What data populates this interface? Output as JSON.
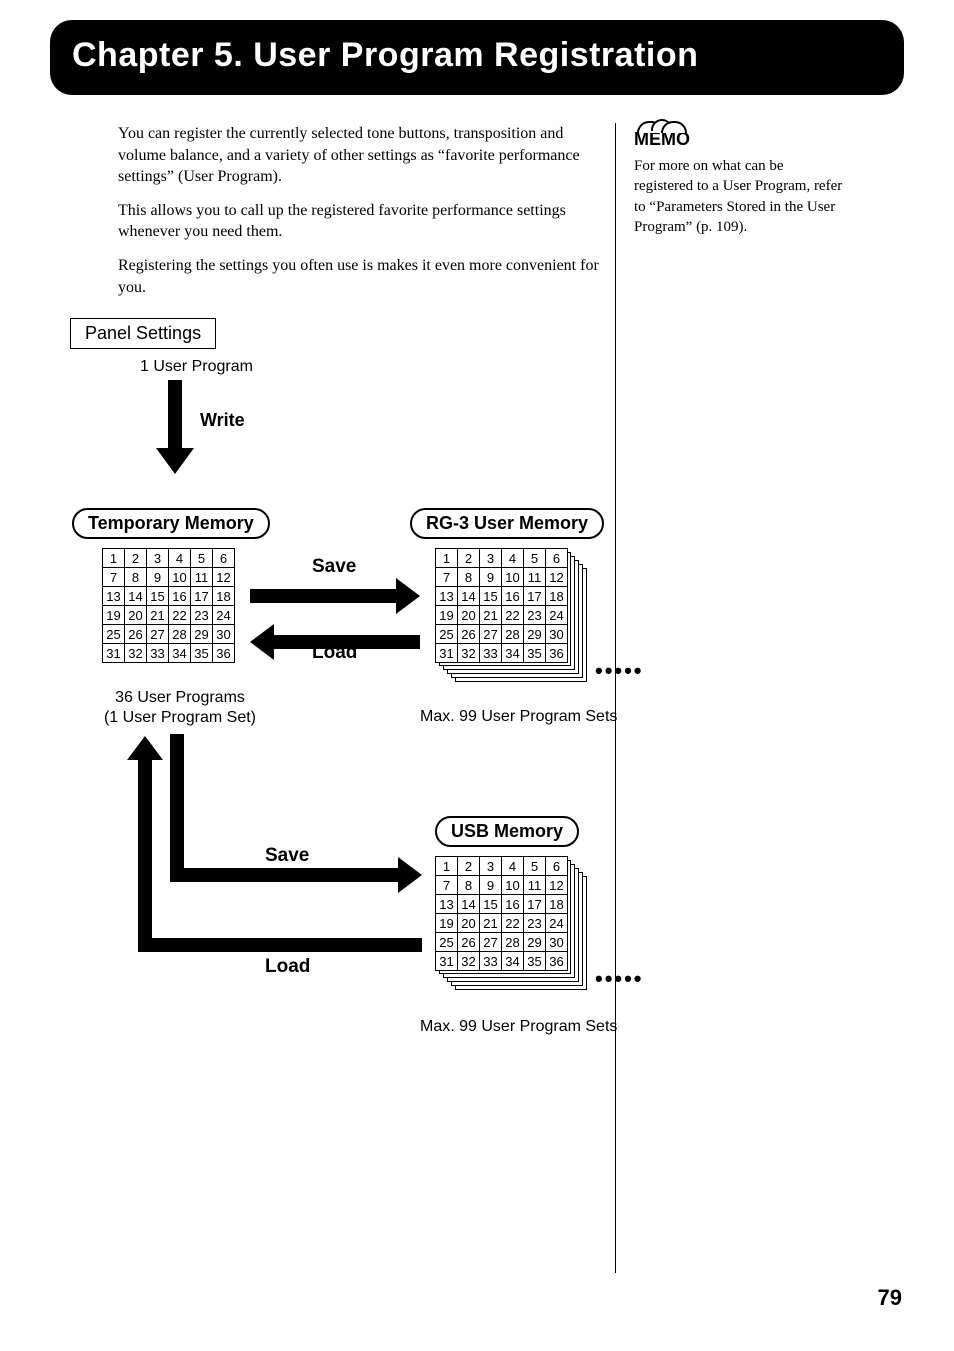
{
  "chapter_title": "Chapter 5. User Program Registration",
  "intro": {
    "p1": "You can register the currently selected tone buttons, transposition and volume balance, and a variety of other settings as “favorite performance settings” (User Program).",
    "p2": "This allows you to call up the registered favorite performance settings whenever you need them.",
    "p3": "Registering the settings you often use is makes it even more convenient for you."
  },
  "memo": {
    "label": "MEMO",
    "text": "For more on what can be registered to a User Program, refer to “Parameters Stored in the User Program” (p. 109)."
  },
  "diagram": {
    "panel_settings": "Panel Settings",
    "one_user_program": "1 User Program",
    "write": "Write",
    "temporary_memory": "Temporary Memory",
    "rg3_user_memory": "RG-3 User Memory",
    "usb_memory": "USB Memory",
    "save": "Save",
    "load": "Load",
    "thirtysix_note_l1": "36 User Programs",
    "thirtysix_note_l2": "(1 User Program Set)",
    "max99": "Max. 99 User Program Sets",
    "grid_cells": [
      "1",
      "2",
      "3",
      "4",
      "5",
      "6",
      "7",
      "8",
      "9",
      "10",
      "11",
      "12",
      "13",
      "14",
      "15",
      "16",
      "17",
      "18",
      "19",
      "20",
      "21",
      "22",
      "23",
      "24",
      "25",
      "26",
      "27",
      "28",
      "29",
      "30",
      "31",
      "32",
      "33",
      "34",
      "35",
      "36"
    ]
  },
  "page_number": "79"
}
